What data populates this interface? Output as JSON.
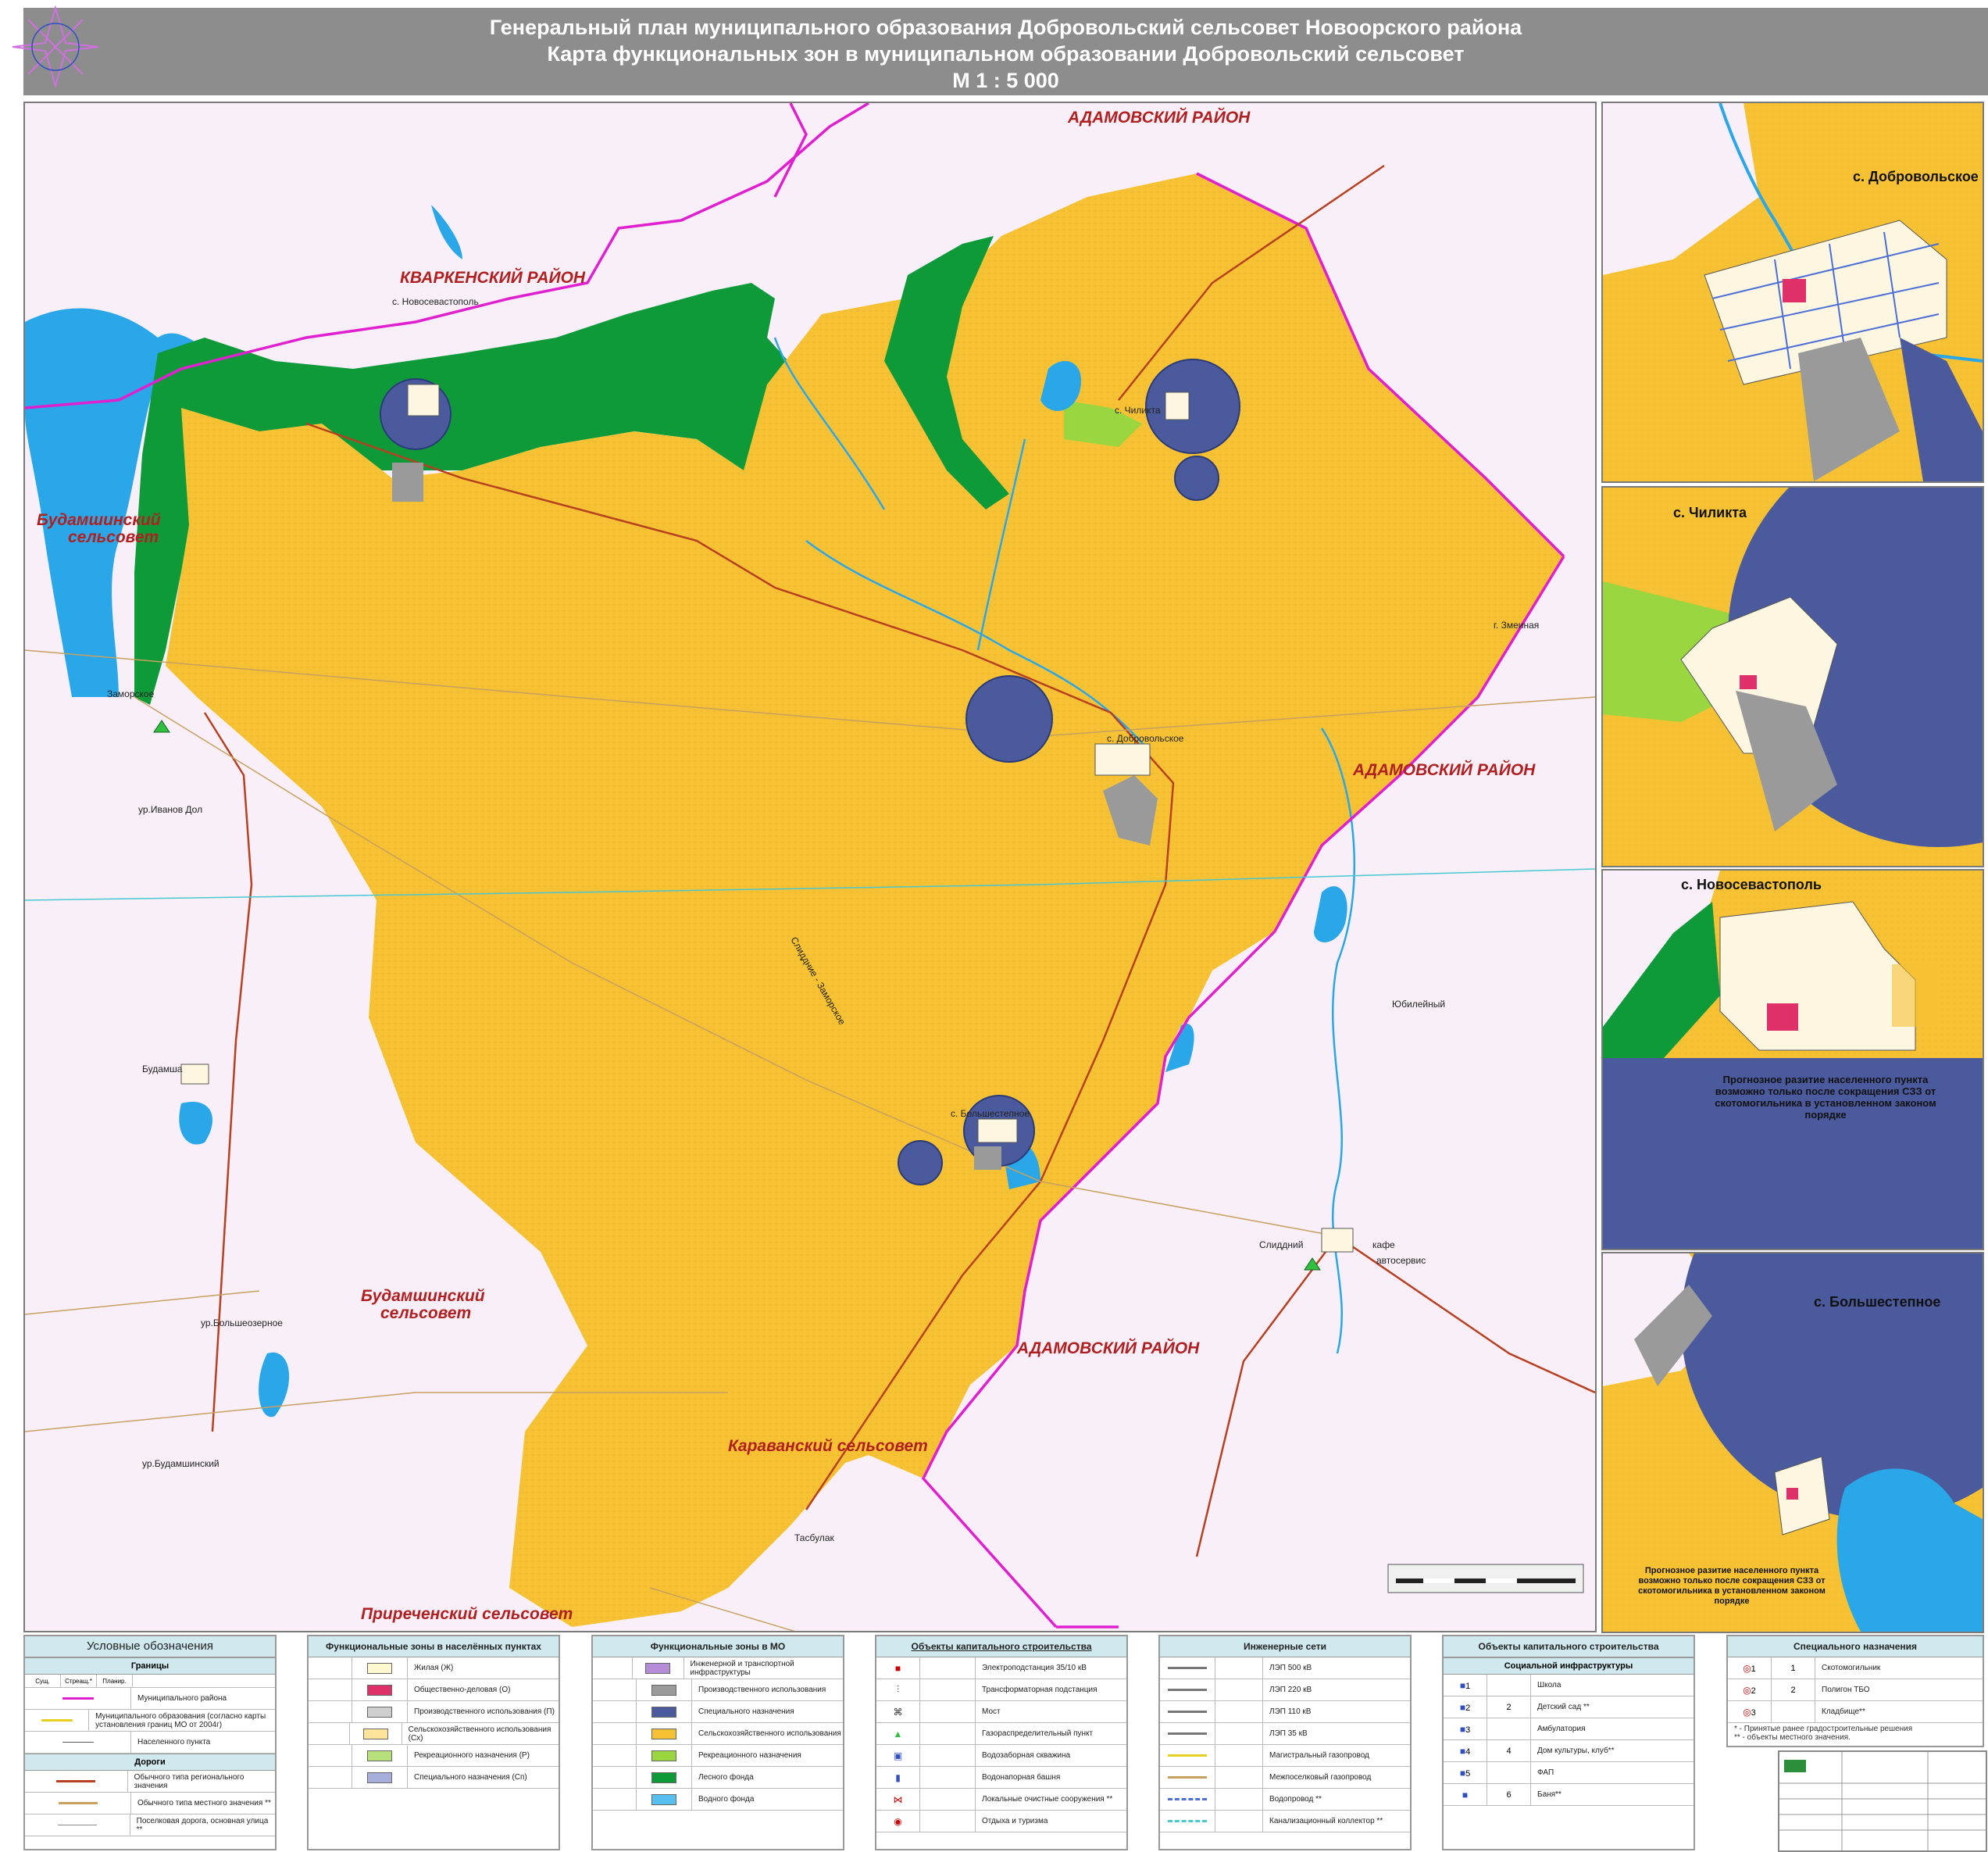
{
  "header": {
    "line1": "Генеральный план муниципального образования  Добровольский сельсовет Новоорского  района",
    "line2": "Карта функциональных зон в муниципальном образовании  Добровольский  сельсовет",
    "scale": "М 1 : 5 000"
  },
  "map": {
    "labels": {
      "adamovsky_top": "АДАМОВСКИЙ РАЙОН",
      "adamovsky_mid": "АДАМОВСКИЙ РАЙОН",
      "adamovsky_low": "АДАМОВСКИЙ РАЙОН",
      "kvarkensky": "КВАРКЕНСКИЙ РАЙОН",
      "budamsh_top_1": "Будамшинский",
      "budamsh_top_2": "сельсовет",
      "budamsh_low_1": "Будамшинский",
      "budamsh_low_2": "сельсовет",
      "karavansky": "Караванский  сельсовет",
      "prirechensky": "Приреченский сельсовет"
    },
    "places": {
      "novosevastopol": "с. Новосевастополь",
      "chilikta": "с. Чиликта",
      "dobrovolskoe": "с. Добровольское",
      "bolshestepnoe": "с. Большестепное",
      "zamorskoe": "Заморское",
      "ivanov_dol": "ур.Иванов Дол",
      "budamsha": "Будамша",
      "bolsheozernoe": "ур.Большеозерное",
      "budamshinsky": "ур.Будамшинский",
      "zmeinaya": "г. Змеиная",
      "yubileyny": "Юбилейный",
      "slianie": "Слиддний",
      "kafe": "кафе",
      "avtoservis": "автосервис",
      "tasbulak": "Тасбулак",
      "road_slit_zam": "Слиддние - Заморское"
    }
  },
  "insets": [
    {
      "title": "с. Добровольское",
      "note": ""
    },
    {
      "title": "с.  Чиликта",
      "note": ""
    },
    {
      "title": "с.  Новосевастополь",
      "note": "Прогнозное разитие населенного пункта возможно  только  после  сокращения СЗЗ от скотомогильника в установленном законом порядке"
    },
    {
      "title": "с.  Большестепное",
      "note": "Прогнозное разитие населенного пункта возможно  только  после  сокращения СЗЗ от скотомогильника в установленном законом порядке"
    }
  ],
  "legend": {
    "main_title": "Условные обозначения",
    "boundaries": {
      "title": "Границы",
      "cols": [
        "Сущ.",
        "Стреащ.*",
        "Планир."
      ],
      "items": [
        "Муниципального района",
        "Муниципального образования (согласно карты установления границ МО от 2004г)",
        "Населенного пункта"
      ]
    },
    "roads": {
      "title": "Дороги",
      "items": [
        "Обычного типа регионального значения",
        "Обычного типа местного значения  **",
        "Поселковая дорога, основная улица **"
      ]
    },
    "zones_settlements": {
      "title": "Функциональные зоны в населённых пунктах",
      "items": [
        {
          "label": "Жилая (Ж)",
          "color": "#fff8d0"
        },
        {
          "label": "Общественно-деловая (О)",
          "color": "#e0306a"
        },
        {
          "label": "Производственного использования (П)",
          "color": "#cfcfcf"
        },
        {
          "label": "Сельскохозяйственного использования (Сх)",
          "color": "#fde49a"
        },
        {
          "label": "Рекреационного назначения (Р)",
          "color": "#b6e07a"
        },
        {
          "label": "Специального назначения (Сп)",
          "color": "#a8aedc"
        }
      ]
    },
    "zones_mo": {
      "title": "Функциональные зоны в МО",
      "items": [
        {
          "label": "Инженерной и транспортной инфраструктуры",
          "color": "#b58cd8"
        },
        {
          "label": "Производственного использования",
          "color": "#9a9a9a"
        },
        {
          "label": "Специального назначения",
          "color": "#4a5a9c"
        },
        {
          "label": "Сельскохозяйственного использования",
          "color": "#f6c234"
        },
        {
          "label": "Рекреационного назначения",
          "color": "#9ad640"
        },
        {
          "label": "Лесного фонда",
          "color": "#0f9a3a"
        },
        {
          "label": "Водного фонда",
          "color": "#58c0f0"
        }
      ]
    },
    "capital": {
      "title": "Объекты  капитального строительства",
      "items": [
        "Электроподстанция 35/10 кВ",
        "Трансформаторная подстанция",
        "Мост",
        "Газораспределительный пункт",
        "Водозаборная скважина",
        "Водонапорная башня",
        "Локальные очистные сооружения  **",
        "Отдыха и туризма"
      ]
    },
    "engineering": {
      "title": "Инженерные сети",
      "items": [
        "ЛЭП 500 кВ",
        "ЛЭП 220 кВ",
        "ЛЭП 110 кВ",
        "ЛЭП 35 кВ",
        "Магистральный газопровод",
        "Межпоселковый газопровод",
        "Водопровод **",
        "Канализационный коллектор **"
      ]
    },
    "social": {
      "title": "Объекты капитального строительства",
      "subtitle": "Социальной инфраструктуры",
      "items": [
        {
          "n": "1",
          "n2": "",
          "label": "Школа"
        },
        {
          "n": "2",
          "n2": "2",
          "label": "Детский сад **"
        },
        {
          "n": "3",
          "n2": "",
          "label": "Амбулатория"
        },
        {
          "n": "4",
          "n2": "4",
          "label": "Дом  культуры, клуб**"
        },
        {
          "n": "5",
          "n2": "",
          "label": "ФАП"
        },
        {
          "n": "",
          "n2": "6",
          "label": "Баня**"
        }
      ]
    },
    "special": {
      "title": "Специального назначения",
      "items": [
        {
          "n": "1",
          "n2": "1",
          "label": "Скотомогильник"
        },
        {
          "n": "2",
          "n2": "2",
          "label": "Полигон ТБО"
        },
        {
          "n": "3",
          "n2": "",
          "label": "Кладбище**"
        }
      ],
      "footnote1": "* - Принятые ранее градостроительные решения",
      "footnote2": "** - объекты местного значения."
    }
  },
  "colors": {
    "agri": "#f6c234",
    "forest": "#0f9a3a",
    "recreation": "#9ad640",
    "water": "#2aa7e8",
    "special": "#4a5a9c",
    "industrial": "#9a9a9a",
    "background": "#f8eff8",
    "boundary": "#e020d0",
    "road": "#b84020"
  }
}
